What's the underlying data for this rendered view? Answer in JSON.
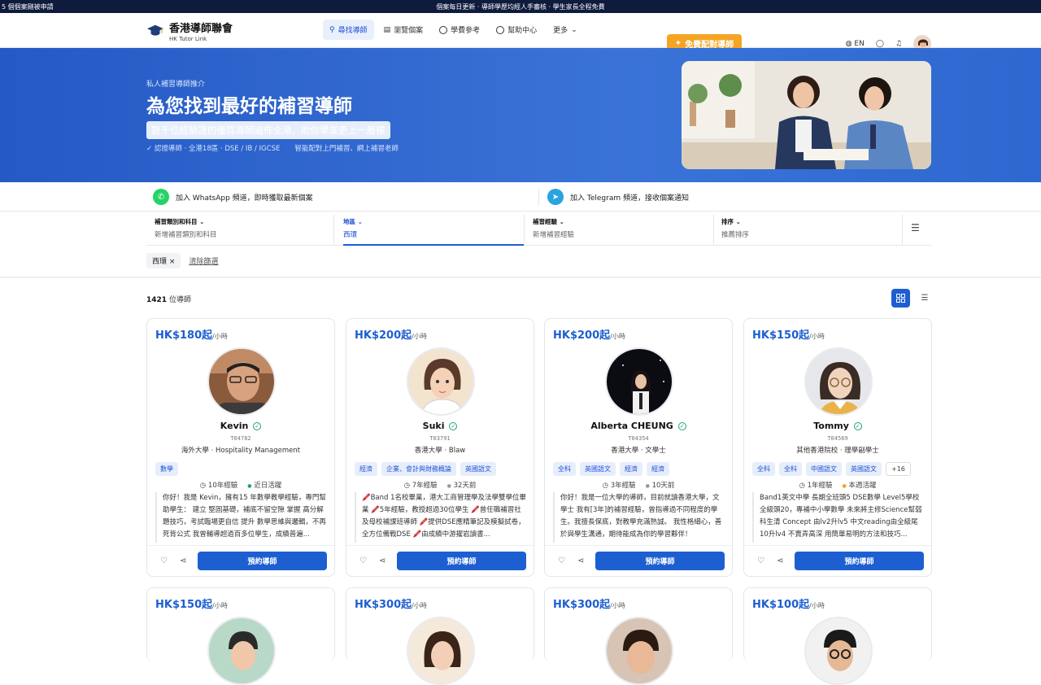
{
  "topbar": {
    "left": "5 個個案剛被申請",
    "center": "個案每日更新 · 導師學歷均經人手審核 · 學生家長全程免費"
  },
  "brand": {
    "name": "香港導師聯會",
    "en": "HK Tutor Link"
  },
  "nav": {
    "find": "尋找導師",
    "cases": "瀏覽個案",
    "fees": "學費參考",
    "help": "幫助中心",
    "more": "更多",
    "cta": "免費配對導師",
    "lang": "EN"
  },
  "hero": {
    "kicker": "私人補習導師推介",
    "title": "為您找到最好的補習導師",
    "sub": "數千位經驗證的優質導師遍佈全港，助你學業更上一層樓",
    "tag1": "認證導師 · 全港18區 · DSE / IB / IGCSE",
    "tag2": "智能配對上門補習、網上補習老師"
  },
  "channels": {
    "whatsapp": "加入 WhatsApp 頻道，即時獲取最新個案",
    "telegram": "加入 Telegram 頻道，接收個案通知"
  },
  "filters": [
    {
      "label": "補習類別和科目",
      "value": "新增補習類別和科目"
    },
    {
      "label": "地區",
      "value": "西環"
    },
    {
      "label": "補習經驗",
      "value": "新增補習經驗"
    },
    {
      "label": "排序",
      "value": "推薦排序"
    }
  ],
  "chips": {
    "active": "西環",
    "clear": "清除篩選"
  },
  "results": {
    "count": "1421",
    "unit": "位導師"
  },
  "card_common": {
    "per": "/小時",
    "book": "預約導師"
  },
  "tutors": [
    {
      "price": "HK$180起",
      "name": "Kevin",
      "id": "T04782",
      "school": "海外大學 · Hospitality Management",
      "subjects": [
        "數學"
      ],
      "exp": "10年經驗",
      "active": "近日活躍",
      "bio": "你好！我是 Kevin，擁有15 年數學教學經驗，專門幫助學生： 建立 堅固基礎，補底不留空隙 掌握 高分解題技巧，考試臨場更自信 提升 數學思維與邏輯，不再死背公式 我曾輔導超過百多位學生，成績普遍..."
    },
    {
      "price": "HK$200起",
      "name": "Suki",
      "id": "T03791",
      "school": "香港大學 · Blaw",
      "subjects": [
        "經濟",
        "企業、會計與財務概論",
        "英國語文"
      ],
      "exp": "7年經驗",
      "active": "32天前",
      "bio": "🖍️Band 1名校畢業，港大工商管理學及法學雙學位畢業 🖍️5年經驗，教授超過30位學生 🖍️曾任職補習社及母校補課班導師 🖍️提供DSE應精筆記及模擬試卷，全方位備戰DSE 🖍️由成績中游擢岩讀書..."
    },
    {
      "price": "HK$200起",
      "name": "Alberta CHEUNG",
      "id": "T04354",
      "school": "香港大學 · 文學士",
      "subjects": [
        "全科",
        "英國語文",
        "經濟",
        "經濟"
      ],
      "exp": "3年經驗",
      "active": "10天前",
      "bio": "你好！我是一位大學的導師，目前就讀香港大學，文學士 我有[3年]的補習經驗，曾指導過不同程度的學生。我擅長保底，對教學充滿熱誠。 我性格細心，善於與學生溝通，期待能成為你的學習夥伴！"
    },
    {
      "price": "HK$150起",
      "name": "Tommy",
      "id": "T04569",
      "school": "其他香港院校 · 理學副學士",
      "subjects": [
        "全科",
        "全科",
        "中國語文",
        "英國語文"
      ],
      "more": "+16",
      "exp": "1年經驗",
      "active": "本週活躍",
      "bio": "Band1英文中學 長期全班頭5 DSE數學 Level5學校全級頭20，專補中小學數學 未來將主修Science幫弱科生清 Concept 由lv2升lv5 中文reading由全級尾10升lv4 不賣弄高深 用簡單易明的方法和技巧..."
    }
  ],
  "tutors_row2": [
    {
      "price": "HK$150起"
    },
    {
      "price": "HK$300起"
    },
    {
      "price": "HK$300起"
    },
    {
      "price": "HK$100起"
    }
  ]
}
